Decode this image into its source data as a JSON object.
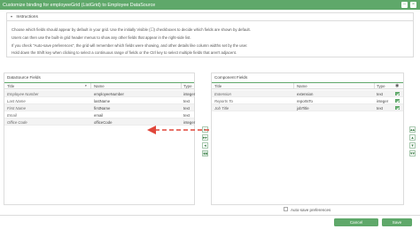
{
  "window": {
    "title": "Customize binding for employeeGrid (ListGrid) to Employee DataSource",
    "minimize_glyph": "–",
    "close_glyph": "×"
  },
  "instructions": {
    "heading": "Instructions",
    "lines": [
      "Choose which fields should appear by default in your grid. Use the initially Visible (☐) checkboxes to decide which fields are shown by default.",
      "Users can then use the built-in grid header menus to show any other fields that appear in the right-side list.",
      "If you check \"Auto-save preferences\", the grid will remember which fields were showing, and other details like column widths set by the user.",
      "Hold down the Shift key when clicking to select a continuous range of fields or the Ctrl key to select multiple fields that aren't adjacent."
    ]
  },
  "left_pane": {
    "title": "DataSource Fields",
    "columns": [
      "Title",
      "Name",
      "Type"
    ],
    "rows": [
      {
        "title": "Employee Number",
        "name": "employeeNumber",
        "type": "integer"
      },
      {
        "title": "Last Name",
        "name": "lastName",
        "type": "text"
      },
      {
        "title": "First Name",
        "name": "firstName",
        "type": "text"
      },
      {
        "title": "Email",
        "name": "email",
        "type": "text"
      },
      {
        "title": "Office Code",
        "name": "officeCode",
        "type": "integer"
      }
    ]
  },
  "right_pane": {
    "title": "Component Fields",
    "columns": [
      "Title",
      "Name",
      "Type"
    ],
    "visible_icon": "eye-icon",
    "rows": [
      {
        "title": "Extension",
        "name": "extension",
        "type": "text",
        "visible": true
      },
      {
        "title": "Reports To",
        "name": "reportsTo",
        "type": "integer",
        "visible": true
      },
      {
        "title": "Job Title",
        "name": "jobTitle",
        "type": "text",
        "visible": true
      }
    ]
  },
  "transfer_buttons": [
    "▸",
    "▸▸",
    "◂",
    "◂◂"
  ],
  "order_buttons": [
    "▴▴",
    "▴",
    "▾",
    "▾▾"
  ],
  "autosave": {
    "label": "Auto-save preferences",
    "checked": false
  },
  "footer": {
    "cancel_label": "Cancel",
    "save_label": "Save"
  },
  "colors": {
    "accent": "#5fa86a",
    "arrow": "#e0463a"
  }
}
